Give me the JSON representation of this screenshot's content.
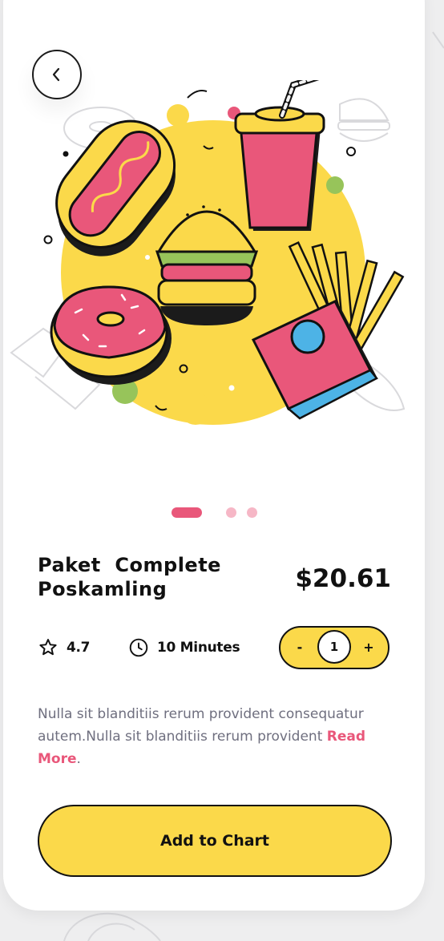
{
  "product": {
    "title_line1": "Paket  Complete",
    "title_line2": "Poskamling",
    "price": "$20.61"
  },
  "meta": {
    "rating": "4.7",
    "duration": "10 Minutes"
  },
  "quantity": {
    "minus_label": "-",
    "value": "1",
    "plus_label": "+"
  },
  "description": {
    "text": "Nulla sit blanditiis rerum provident consequatur autem.Nulla sit blanditiis rerum provident ",
    "read_more": "Read More",
    "trailing": "."
  },
  "carousel": {
    "total": 3,
    "active_index": 0
  },
  "actions": {
    "add_label": "Add to Chart"
  },
  "icons": {
    "back": "chevron-left-icon",
    "rating": "star-outline-icon",
    "duration": "clock-icon"
  },
  "colors": {
    "accent_yellow": "#fbd94a",
    "accent_pink": "#e9577a",
    "light_pink": "#f6b7c6",
    "text_dark": "#111111",
    "text_muted": "#6f6f7f"
  }
}
